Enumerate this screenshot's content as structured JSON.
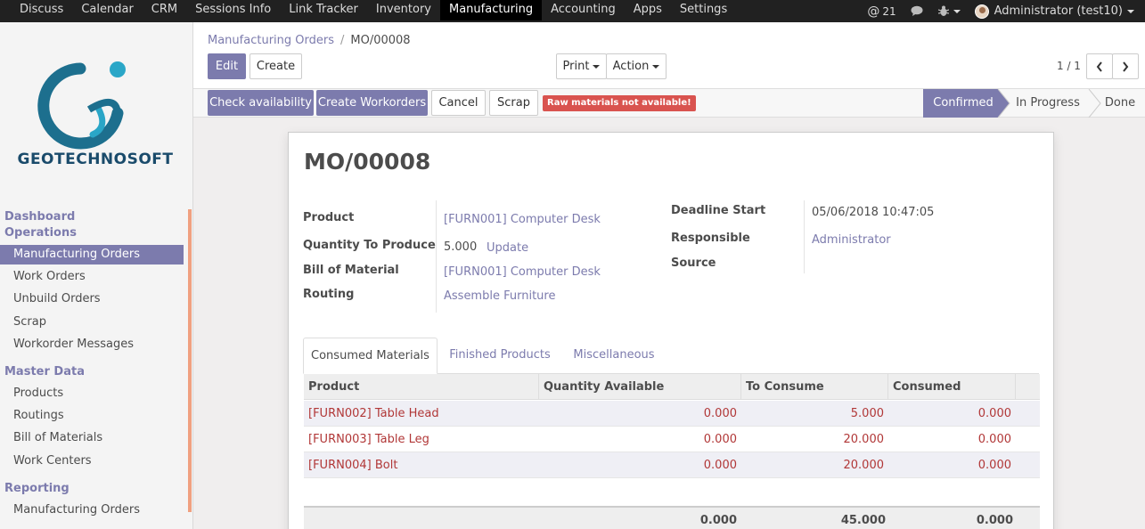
{
  "topbar": {
    "menu": [
      "Discuss",
      "Calendar",
      "CRM",
      "Sessions Info",
      "Link Tracker",
      "Inventory",
      "Manufacturing",
      "Accounting",
      "Apps",
      "Settings"
    ],
    "active_menu": "Manufacturing",
    "messages_count": "21",
    "user": "Administrator (test10)"
  },
  "sidebar": {
    "logo_text": "GEOTECHNOSOFT",
    "sections": [
      {
        "title": "Dashboard Operations",
        "items": [
          "Manufacturing Orders",
          "Work Orders",
          "Unbuild Orders",
          "Scrap",
          "Workorder Messages"
        ]
      },
      {
        "title": "Master Data",
        "items": [
          "Products",
          "Routings",
          "Bill of Materials",
          "Work Centers"
        ]
      },
      {
        "title": "Reporting",
        "items": [
          "Manufacturing Orders"
        ]
      }
    ],
    "active_item": "Manufacturing Orders"
  },
  "control_panel": {
    "breadcrumb_parent": "Manufacturing Orders",
    "breadcrumb_separator": "/",
    "breadcrumb_current": "MO/00008",
    "edit_label": "Edit",
    "create_label": "Create",
    "print_label": "Print",
    "action_label": "Action",
    "pager": "1 / 1"
  },
  "header": {
    "buttons": [
      "Check availability",
      "Create Workorders",
      "Cancel",
      "Scrap"
    ],
    "warning_badge": "Raw materials not available!",
    "stages": [
      "Confirmed",
      "In Progress",
      "Done"
    ],
    "current_stage": "Confirmed"
  },
  "form": {
    "name": "MO/00008",
    "product_label": "Product",
    "product_value": "[FURN001] Computer Desk",
    "qty_label": "Quantity To Produce",
    "qty_value": "5.000",
    "qty_update": "Update",
    "bom_label": "Bill of Material",
    "bom_value": "[FURN001] Computer Desk",
    "routing_label": "Routing",
    "routing_value": "Assemble Furniture",
    "deadline_label": "Deadline Start",
    "deadline_value": "05/06/2018 10:47:05",
    "responsible_label": "Responsible",
    "responsible_value": "Administrator",
    "source_label": "Source",
    "source_value": ""
  },
  "tabs": [
    "Consumed Materials",
    "Finished Products",
    "Miscellaneous"
  ],
  "active_tab": "Consumed Materials",
  "table": {
    "columns": [
      "Product",
      "Quantity Available",
      "To Consume",
      "Consumed"
    ],
    "rows": [
      [
        "[FURN002] Table Head",
        "0.000",
        "5.000",
        "0.000"
      ],
      [
        "[FURN003] Table Leg",
        "0.000",
        "20.000",
        "0.000"
      ],
      [
        "[FURN004] Bolt",
        "0.000",
        "20.000",
        "0.000"
      ]
    ],
    "totals": [
      "0.000",
      "45.000",
      "0.000"
    ]
  },
  "colors": {
    "accent": "#7c7bad",
    "topbar": "#212121",
    "danger": "#d9534f",
    "line_text": "#b13737"
  }
}
